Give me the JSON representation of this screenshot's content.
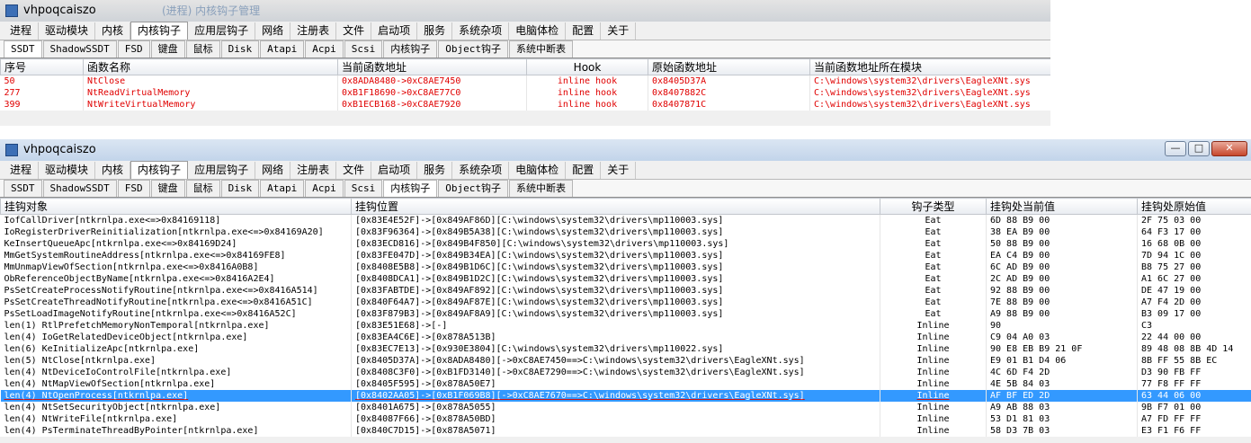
{
  "window1": {
    "title": "vhpoqcaiszo",
    "main_tabs": [
      "进程",
      "驱动模块",
      "内核",
      "内核钩子",
      "应用层钩子",
      "网络",
      "注册表",
      "文件",
      "启动项",
      "服务",
      "系统杂项",
      "电脑体检",
      "配置",
      "关于"
    ],
    "active_main_tab": "内核钩子",
    "sub_tabs": [
      "SSDT",
      "ShadowSSDT",
      "FSD",
      "键盘",
      "鼠标",
      "Disk",
      "Atapi",
      "Acpi",
      "Scsi",
      "内核钩子",
      "Object钩子",
      "系统中断表"
    ],
    "active_sub_tab": "SSDT",
    "columns": [
      "序号",
      "函数名称",
      "当前函数地址",
      "Hook",
      "原始函数地址",
      "当前函数地址所在模块"
    ],
    "rows": [
      [
        "50",
        "NtClose",
        "0x8ADA8480->0xC8AE7450",
        "inline hook",
        "0x8405D37A",
        "C:\\windows\\system32\\drivers\\EagleXNt.sys"
      ],
      [
        "277",
        "NtReadVirtualMemory",
        "0xB1F18690->0xC8AE77C0",
        "inline hook",
        "0x8407882C",
        "C:\\windows\\system32\\drivers\\EagleXNt.sys"
      ],
      [
        "399",
        "NtWriteVirtualMemory",
        "0xB1ECB168->0xC8AE7920",
        "inline hook",
        "0x8407871C",
        "C:\\windows\\system32\\drivers\\EagleXNt.sys"
      ]
    ],
    "ghost_text": "(进程) 内核钩子管理"
  },
  "window2": {
    "title": "vhpoqcaiszo",
    "main_tabs": [
      "进程",
      "驱动模块",
      "内核",
      "内核钩子",
      "应用层钩子",
      "网络",
      "注册表",
      "文件",
      "启动项",
      "服务",
      "系统杂项",
      "电脑体检",
      "配置",
      "关于"
    ],
    "active_main_tab": "内核钩子",
    "sub_tabs": [
      "SSDT",
      "ShadowSSDT",
      "FSD",
      "键盘",
      "鼠标",
      "Disk",
      "Atapi",
      "Acpi",
      "Scsi",
      "内核钩子",
      "Object钩子",
      "系统中断表"
    ],
    "active_sub_tab": "内核钩子",
    "window_buttons": {
      "minimize": "—",
      "maximize": "□",
      "close": "✕"
    },
    "columns": [
      "挂钩对象",
      "挂钩位置",
      "钩子类型",
      "挂钩处当前值",
      "挂钩处原始值"
    ],
    "rows": [
      [
        "IofCallDriver[ntkrnlpa.exe<=>0x84169118]",
        "[0x83E4E52F]->[0x849AF86D][C:\\windows\\system32\\drivers\\mp110003.sys]",
        "Eat",
        "6D 88 B9 00",
        "2F 75 03 00"
      ],
      [
        "IoRegisterDriverReinitialization[ntkrnlpa.exe<=>0x84169A20]",
        "[0x83F96364]->[0x849B5A38][C:\\windows\\system32\\drivers\\mp110003.sys]",
        "Eat",
        "38 EA B9 00",
        "64 F3 17 00"
      ],
      [
        "KeInsertQueueApc[ntkrnlpa.exe<=>0x84169D24]",
        "[0x83ECD816]->[0x849B4F850][C:\\windows\\system32\\drivers\\mp110003.sys]",
        "Eat",
        "50 88 B9 00",
        "16 68 0B 00"
      ],
      [
        "MmGetSystemRoutineAddress[ntkrnlpa.exe<=>0x84169FE8]",
        "[0x83FE047D]->[0x849B34EA][C:\\windows\\system32\\drivers\\mp110003.sys]",
        "Eat",
        "EA C4 B9 00",
        "7D 94 1C 00"
      ],
      [
        "MmUnmapViewOfSection[ntkrnlpa.exe<=>0x8416A0B8]",
        "[0x8408E5B8]->[0x849B1D6C][C:\\windows\\system32\\drivers\\mp110003.sys]",
        "Eat",
        "6C AD B9 00",
        "B8 75 27 00"
      ],
      [
        "ObReferenceObjectByName[ntkrnlpa.exe<=>0x8416A2E4]",
        "[0x8408DCA1]->[0x849B1D2C][C:\\windows\\system32\\drivers\\mp110003.sys]",
        "Eat",
        "2C AD B9 00",
        "A1 6C 27 00"
      ],
      [
        "PsSetCreateProcessNotifyRoutine[ntkrnlpa.exe<=>0x8416A514]",
        "[0x83FABTDE]->[0x849AF892][C:\\windows\\system32\\drivers\\mp110003.sys]",
        "Eat",
        "92 88 B9 00",
        "DE 47 19 00"
      ],
      [
        "PsSetCreateThreadNotifyRoutine[ntkrnlpa.exe<=>0x8416A51C]",
        "[0x840F64A7]->[0x849AF87E][C:\\windows\\system32\\drivers\\mp110003.sys]",
        "Eat",
        "7E 88 B9 00",
        "A7 F4 2D 00"
      ],
      [
        "PsSetLoadImageNotifyRoutine[ntkrnlpa.exe<=>0x8416A52C]",
        "[0x83F879B3]->[0x849AF8A9][C:\\windows\\system32\\drivers\\mp110003.sys]",
        "Eat",
        "A9 88 B9 00",
        "B3 09 17 00"
      ],
      [
        "len(1) RtlPrefetchMemoryNonTemporal[ntkrnlpa.exe]",
        "[0x83E51E68]->[-]",
        "Inline",
        "90",
        "C3"
      ],
      [
        "len(4) IoGetRelatedDeviceObject[ntkrnlpa.exe]",
        "[0x83EA4C6E]->[0x878A513B]",
        "Inline",
        "C9 04 A0 03",
        "22 44 00 00"
      ],
      [
        "len(6) KeInitializeApc[ntkrnlpa.exe]",
        "[0x83EC7E13]->[0x930E3804][C:\\windows\\system32\\drivers\\mp110022.sys]",
        "Inline",
        "90 E8 EB B9 21 0F",
        "89 48 08 8B 4D 14"
      ],
      [
        "len(5) NtClose[ntkrnlpa.exe]",
        "[0x8405D37A]->[0x8ADA8480][->0xC8AE7450==>C:\\windows\\system32\\drivers\\EagleXNt.sys]",
        "Inline",
        "E9 01 B1 D4 06",
        "8B FF 55 8B EC"
      ],
      [
        "len(4) NtDeviceIoControlFile[ntkrnlpa.exe]",
        "[0x8408C3F0]->[0xB1FD3140][->0xC8AE7290==>C:\\windows\\system32\\drivers\\EagleXNt.sys]",
        "Inline",
        "4C 6D F4 2D",
        "D3 90 FB FF"
      ],
      [
        "len(4) NtMapViewOfSection[ntkrnlpa.exe]",
        "[0x8405F595]->[0x878A50E7]",
        "Inline",
        "4E 5B 84 03",
        "77 F8 FF FF"
      ],
      [
        "len(4) NtOpenProcess[ntkrnlpa.exe]",
        "[0x8402AA05]->[0xB1F069B8][->0xC8AE7670==>C:\\windows\\system32\\drivers\\EagleXNt.sys]",
        "Inline",
        "AF BF ED 2D",
        "63 44 06 00"
      ],
      [
        "len(4) NtSetSecurityObject[ntkrnlpa.exe]",
        "[0x8401A675]->[0x878A5055]",
        "Inline",
        "A9 AB 88 03",
        "9B F7 01 00"
      ],
      [
        "len(4) NtWriteFile[ntkrnlpa.exe]",
        "[0x84087F66]->[0x878A50BD]",
        "Inline",
        "53 D1 81 03",
        "A7 FD FF FF"
      ],
      [
        "len(4) PsTerminateThreadByPointer[ntkrnlpa.exe]",
        "[0x840C7D15]->[0x878A5071]",
        "Inline",
        "58 D3 7B 03",
        "E3 F1 F6 FF"
      ]
    ],
    "selected_row_index": 15
  }
}
